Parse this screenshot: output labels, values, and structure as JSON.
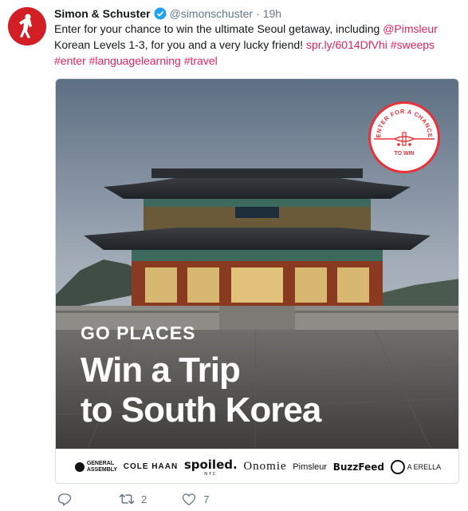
{
  "tweet": {
    "author_name": "Simon & Schuster",
    "handle": "@simonschuster",
    "separator": "·",
    "time": "19h",
    "text_part1": "Enter for your chance to win the ultimate Seoul getaway, including ",
    "mention": "@Pimsleur",
    "text_part2": " Korean Levels 1-3, for you and a very lucky friend! ",
    "link": "spr.ly/6014DfVhi",
    "hashtag1": "#sweeps",
    "hashtag2": "#enter",
    "hashtag3": "#languagelearning",
    "hashtag4": "#travel",
    "space": " "
  },
  "media": {
    "kicker": "GO PLACES",
    "headline_line1": "Win a Trip",
    "headline_line2": "to South Korea",
    "badge_text_top": "ENTER FOR A CHANCE",
    "badge_text_bottom": "TO WIN",
    "sponsors": [
      {
        "line1": "GENERAL",
        "line2": "ASSEMBLY"
      },
      {
        "label": "COLE HAAN"
      },
      {
        "label": "spoiled.",
        "sub": "NYC"
      },
      {
        "label": "Onomie"
      },
      {
        "label": "Pimsleur"
      },
      {
        "label": "BuzzFeed"
      },
      {
        "label": "A  ERELLA"
      }
    ]
  },
  "actions": {
    "retweet_count": "2",
    "like_count": "7"
  },
  "icons": {
    "avatar": "simon-schuster-sower-logo",
    "verified": "verified-badge-icon",
    "reply": "reply-icon",
    "retweet": "retweet-icon",
    "like": "heart-icon"
  },
  "colors": {
    "link": "#e0245e",
    "avatar_bg": "#d21f25",
    "verified": "#1da1f2",
    "meta": "#657786"
  }
}
